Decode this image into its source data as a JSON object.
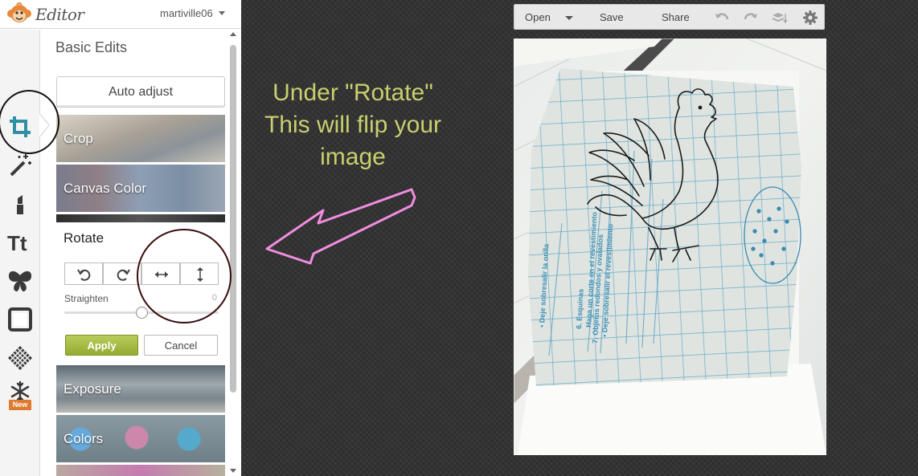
{
  "app": {
    "logo_text": "Editor",
    "username": "martiville06"
  },
  "panel": {
    "title": "Basic Edits",
    "auto_adjust_label": "Auto adjust",
    "tiles": {
      "crop": "Crop",
      "canvas_color": "Canvas Color",
      "exposure": "Exposure",
      "colors": "Colors"
    },
    "rotate": {
      "title": "Rotate",
      "straighten_label": "Straighten",
      "straighten_value": "0",
      "straighten_level": 0.5,
      "apply_label": "Apply",
      "cancel_label": "Cancel"
    }
  },
  "toolbar_icons": [
    "crop-icon",
    "magic-wand-icon",
    "lipstick-icon",
    "text-icon",
    "butterfly-icon",
    "frame-icon",
    "texture-icon",
    "snowflake-icon"
  ],
  "new_badge": "New",
  "editor_toolbar": {
    "open_label": "Open",
    "save_label": "Save",
    "share_label": "Share"
  },
  "annotation": {
    "line1": "Under \"Rotate\"",
    "line2": "This will flip your",
    "line3": "image"
  },
  "colors": {
    "accent_green": "#9bb23a",
    "annotation_text": "#c9cf6e",
    "annotation_arrow": "#f08de0",
    "background": "#333333",
    "tool_blue": "#2f8fa3"
  }
}
